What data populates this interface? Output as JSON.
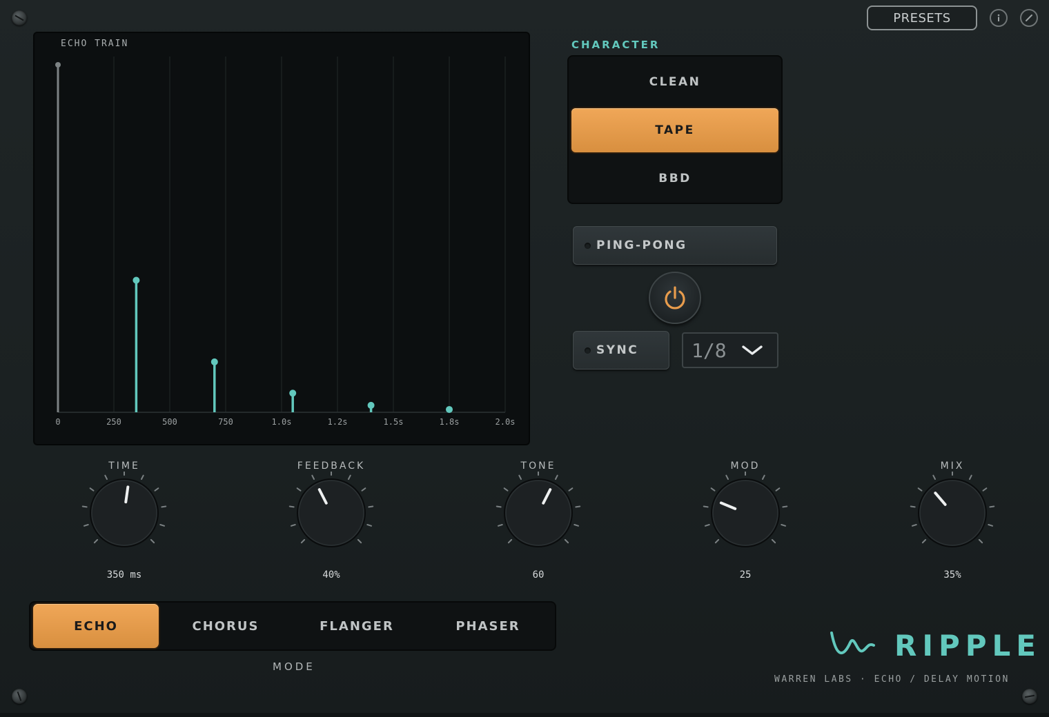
{
  "header": {
    "presets_label": "PRESETS",
    "info_icon": "info-icon",
    "edit_icon": "edit-icon"
  },
  "echo_train": {
    "title": "ECHO TRAIN",
    "x_ticks": [
      "0",
      "250",
      "500",
      "750",
      "1.0s",
      "1.2s",
      "1.5s",
      "1.8s",
      "2.0s"
    ]
  },
  "chart_data": {
    "type": "bar",
    "title": "ECHO TRAIN",
    "x_unit": "ms",
    "x": [
      0,
      350,
      700,
      1050,
      1400,
      1750
    ],
    "values": [
      1.0,
      0.38,
      0.145,
      0.055,
      0.02,
      0.008
    ],
    "xlim": [
      0,
      2000
    ],
    "ylim": [
      0,
      1.0
    ],
    "grid": true,
    "colors": {
      "dry": "#7c8284",
      "echo": "#62c8bd"
    }
  },
  "character": {
    "title": "CHARACTER",
    "options": [
      "CLEAN",
      "TAPE",
      "BBD"
    ],
    "selected": "TAPE"
  },
  "ping_pong": {
    "label": "PING-PONG",
    "on": false
  },
  "power": {
    "icon": "power-icon",
    "on": true
  },
  "sync": {
    "label": "SYNC",
    "on": false
  },
  "division": {
    "value": "1/8",
    "icon": "chevron-down-icon"
  },
  "knobs": [
    {
      "id": "time",
      "label": "TIME",
      "value": "350 ms",
      "position": 0.53
    },
    {
      "id": "feedback",
      "label": "FEEDBACK",
      "value": "40%",
      "position": 0.4
    },
    {
      "id": "tone",
      "label": "TONE",
      "value": "60",
      "position": 0.6
    },
    {
      "id": "mod",
      "label": "MOD",
      "value": "25",
      "position": 0.25
    },
    {
      "id": "mix",
      "label": "MIX",
      "value": "35%",
      "position": 0.35
    }
  ],
  "mode": {
    "label": "MODE",
    "options": [
      "ECHO",
      "CHORUS",
      "FLANGER",
      "PHASER"
    ],
    "selected": "ECHO"
  },
  "brand": {
    "name": "RIPPLE",
    "subtitle": "WARREN LABS  ·  ECHO / DELAY MOTION",
    "logo_icon": "wave-icon"
  },
  "colors": {
    "accent_teal": "#62c8bd",
    "accent_orange": "#e89c4c"
  }
}
